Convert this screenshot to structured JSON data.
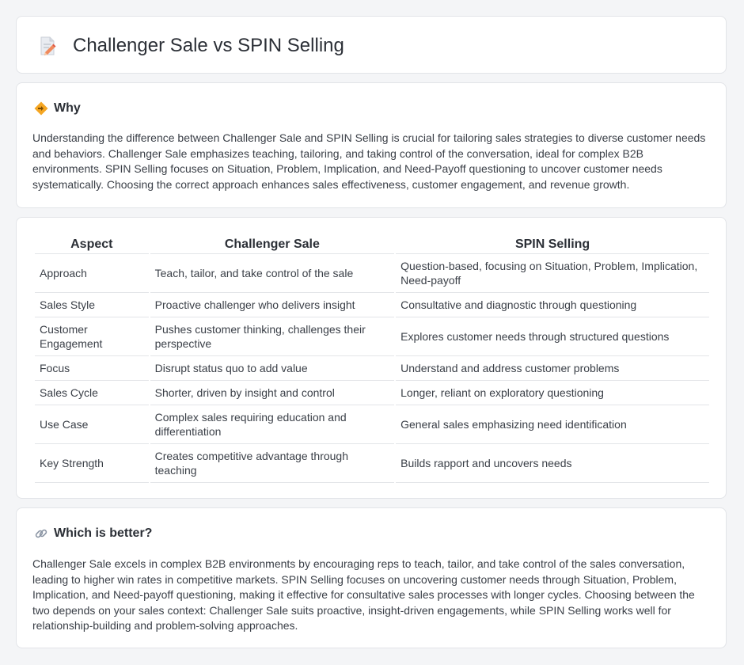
{
  "header": {
    "title": "Challenger Sale vs SPIN Selling",
    "icon": "document-pencil-icon"
  },
  "why": {
    "title": "Why",
    "icon": "diamond-arrows-icon",
    "text": "Understanding the difference between Challenger Sale and SPIN Selling is crucial for tailoring sales strategies to diverse customer needs and behaviors. Challenger Sale emphasizes teaching, tailoring, and taking control of the conversation, ideal for complex B2B environments. SPIN Selling focuses on Situation, Problem, Implication, and Need-Payoff questioning to uncover customer needs systematically. Choosing the correct approach enhances sales effectiveness, customer engagement, and revenue growth."
  },
  "table": {
    "headers": [
      "Aspect",
      "Challenger Sale",
      "SPIN Selling"
    ],
    "rows": [
      [
        "Approach",
        "Teach, tailor, and take control of the sale",
        "Question-based, focusing on Situation, Problem, Implication, Need-payoff"
      ],
      [
        "Sales Style",
        "Proactive challenger who delivers insight",
        "Consultative and diagnostic through questioning"
      ],
      [
        "Customer Engagement",
        "Pushes customer thinking, challenges their perspective",
        "Explores customer needs through structured questions"
      ],
      [
        "Focus",
        "Disrupt status quo to add value",
        "Understand and address customer problems"
      ],
      [
        "Sales Cycle",
        "Shorter, driven by insight and control",
        "Longer, reliant on exploratory questioning"
      ],
      [
        "Use Case",
        "Complex sales requiring education and differentiation",
        "General sales emphasizing need identification"
      ],
      [
        "Key Strength",
        "Creates competitive advantage through teaching",
        "Builds rapport and uncovers needs"
      ]
    ]
  },
  "better": {
    "title": "Which is better?",
    "icon": "link-icon",
    "text": "Challenger Sale excels in complex B2B environments by encouraging reps to teach, tailor, and take control of the sales conversation, leading to higher win rates in competitive markets. SPIN Selling focuses on uncovering customer needs through Situation, Problem, Implication, and Need-payoff questioning, making it effective for consultative sales processes with longer cycles. Choosing between the two depends on your sales context: Challenger Sale suits proactive, insight-driven engagements, while SPIN Selling works well for relationship-building and problem-solving approaches."
  },
  "colors": {
    "background": "#f4f5f7",
    "card": "#ffffff",
    "accent": "#f5a623"
  }
}
